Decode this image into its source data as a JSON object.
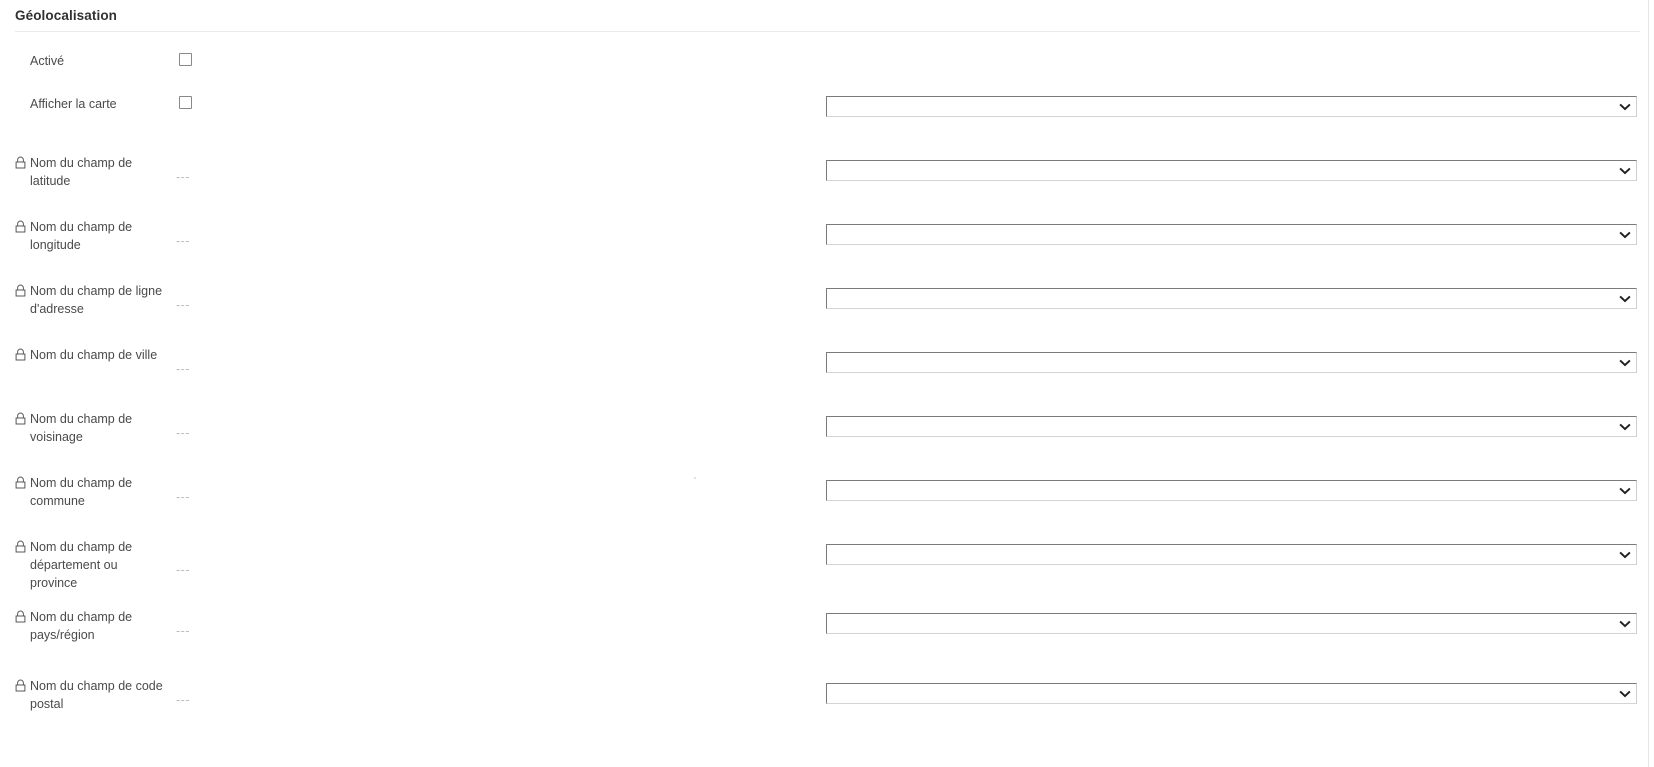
{
  "section": {
    "title": "Géolocalisation"
  },
  "colors": {
    "text": "#323130",
    "label": "#4a4a4a",
    "placeholder": "#bdbdbd",
    "border": "#7a7a78",
    "divider": "#ebebeb"
  },
  "toggles": [
    {
      "label": "Activé",
      "checked": false,
      "state_text": ""
    },
    {
      "label": "Afficher la carte",
      "checked": false,
      "state_text": ""
    }
  ],
  "fields": [
    {
      "label": "Nom du champ de latitude",
      "icon": "lock-icon",
      "value": "---",
      "dropdown_value": ""
    },
    {
      "label": "Nom du champ de longitude",
      "icon": "lock-icon",
      "value": "---",
      "dropdown_value": ""
    },
    {
      "label": "Nom du champ de ligne d'adresse",
      "icon": "lock-icon",
      "value": "---",
      "dropdown_value": ""
    },
    {
      "label": "Nom du champ de ville",
      "icon": "lock-icon",
      "value": "---",
      "dropdown_value": ""
    },
    {
      "label": "Nom du champ de voisinage",
      "icon": "lock-icon",
      "value": "---",
      "dropdown_value": ""
    },
    {
      "label": "Nom du champ de commune",
      "icon": "lock-icon",
      "value": "---",
      "dropdown_value": ""
    },
    {
      "label": "Nom du champ de département ou province",
      "icon": "lock-icon",
      "value": "---",
      "dropdown_value": ""
    },
    {
      "label": "Nom du champ de pays/région",
      "icon": "lock-icon",
      "value": "---",
      "dropdown_value": ""
    },
    {
      "label": "Nom du champ de code postal",
      "icon": "lock-icon",
      "value": "---",
      "dropdown_value": ""
    }
  ]
}
